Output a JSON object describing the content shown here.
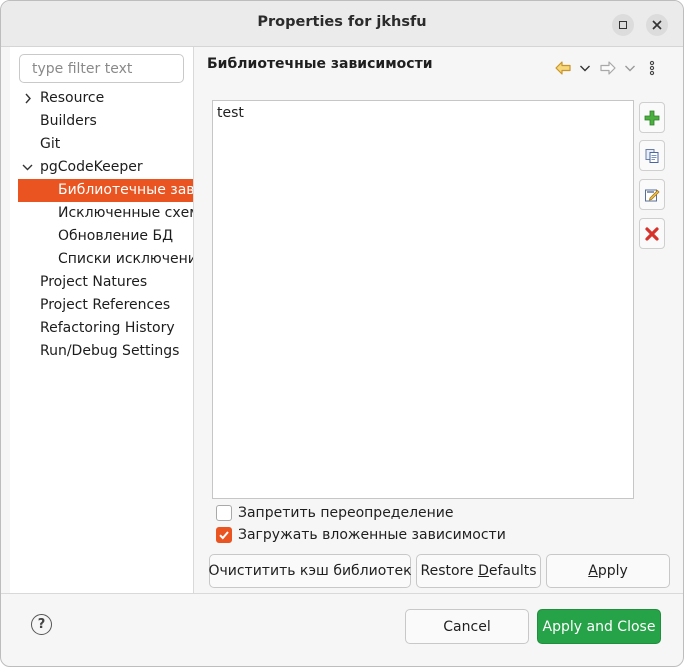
{
  "window": {
    "title": "Properties for jkhsfu"
  },
  "filter": {
    "placeholder": "type filter text",
    "value": ""
  },
  "tree": {
    "items": [
      {
        "label": "Resource",
        "expandable": true,
        "expanded": false
      },
      {
        "label": "Builders"
      },
      {
        "label": "Git"
      },
      {
        "label": "pgCodeKeeper",
        "expandable": true,
        "expanded": true
      },
      {
        "label": "Библиотечные зависимости",
        "selected": true
      },
      {
        "label": "Исключенные схемы"
      },
      {
        "label": "Обновление БД"
      },
      {
        "label": "Списки исключений"
      },
      {
        "label": "Project Natures"
      },
      {
        "label": "Project References"
      },
      {
        "label": "Refactoring History"
      },
      {
        "label": "Run/Debug Settings"
      }
    ]
  },
  "page": {
    "title": "Библиотечные зависимости",
    "list_items": [
      "test"
    ],
    "checkboxes": {
      "forbid_override": {
        "label": "Запретить переопределение",
        "checked": false
      },
      "load_nested": {
        "label": "Загружать вложенные зависимости",
        "checked": true
      }
    },
    "buttons": {
      "clear_cache": "Очиститить кэш библиотек",
      "restore_prefix": "Restore ",
      "restore_mnemonic": "D",
      "restore_suffix": "efaults",
      "apply_mnemonic": "A",
      "apply_suffix": "pply"
    }
  },
  "dialog": {
    "cancel": "Cancel",
    "apply_close": "Apply and Close"
  },
  "colors": {
    "accent": "#e95420",
    "primary_button": "#26a248",
    "add_icon": "#3aa53a",
    "delete_icon": "#d6312b"
  }
}
